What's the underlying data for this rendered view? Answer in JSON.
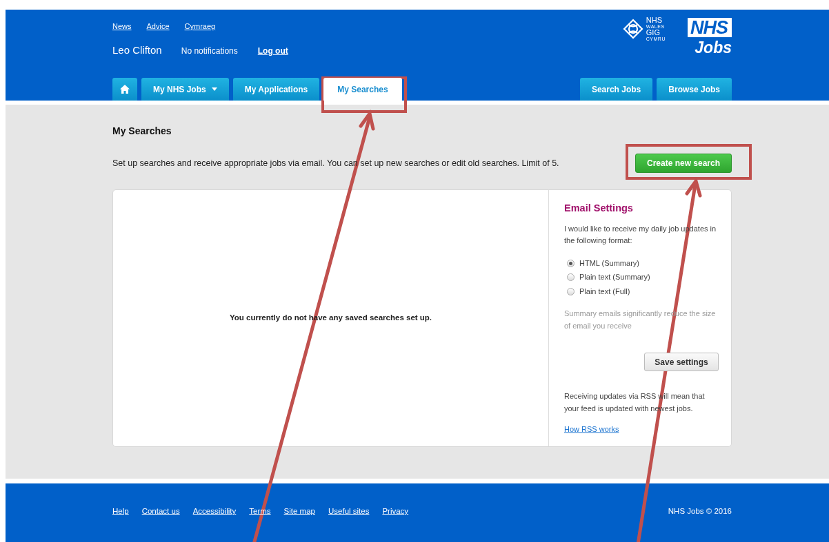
{
  "top_links": [
    {
      "label": "News"
    },
    {
      "label": "Advice"
    },
    {
      "label": "Cymraeg"
    }
  ],
  "user": {
    "name": "Leo Clifton",
    "notifications": "No notifications",
    "logout": "Log out"
  },
  "wales_logo": {
    "line_1": "NHS",
    "line_2": "WALES",
    "line_3": "GIG",
    "line_4": "CYMRU"
  },
  "jobs_logo": {
    "mark": "NHS",
    "word": "Jobs"
  },
  "nav_tabs": [
    {
      "kind": "home",
      "selected": false
    },
    {
      "kind": "dropdown",
      "label": "My NHS Jobs",
      "selected": false
    },
    {
      "kind": "text",
      "label": "My Applications",
      "selected": false
    },
    {
      "kind": "text",
      "label": "My Searches",
      "selected": true
    }
  ],
  "nav_buttons": [
    {
      "label": "Search Jobs"
    },
    {
      "label": "Browse Jobs"
    }
  ],
  "page": {
    "title": "My Searches",
    "intro": "Set up searches and receive appropriate jobs via email. You can set up new searches or edit old searches. Limit of 5.",
    "create_button": "Create new search",
    "empty_message": "You currently do not have any saved searches set up."
  },
  "email_settings": {
    "title": "Email Settings",
    "description": "I would like to receive my daily job updates in the following format:",
    "options": [
      {
        "label": "HTML (Summary)",
        "selected": true
      },
      {
        "label": "Plain text (Summary)",
        "selected": false
      },
      {
        "label": "Plain text (Full)",
        "selected": false
      }
    ],
    "note": "Summary emails significantly reduce the size of email you receive",
    "save_button": "Save settings",
    "rss_text": "Receiving updates via RSS will mean that your feed is updated with newest jobs.",
    "rss_link": "How RSS works"
  },
  "footer": {
    "links": [
      {
        "label": "Help"
      },
      {
        "label": "Contact us"
      },
      {
        "label": "Accessibility"
      },
      {
        "label": "Terms"
      },
      {
        "label": "Site map"
      },
      {
        "label": "Useful sites"
      },
      {
        "label": "Privacy"
      }
    ],
    "copyright": "NHS Jobs © 2016"
  }
}
